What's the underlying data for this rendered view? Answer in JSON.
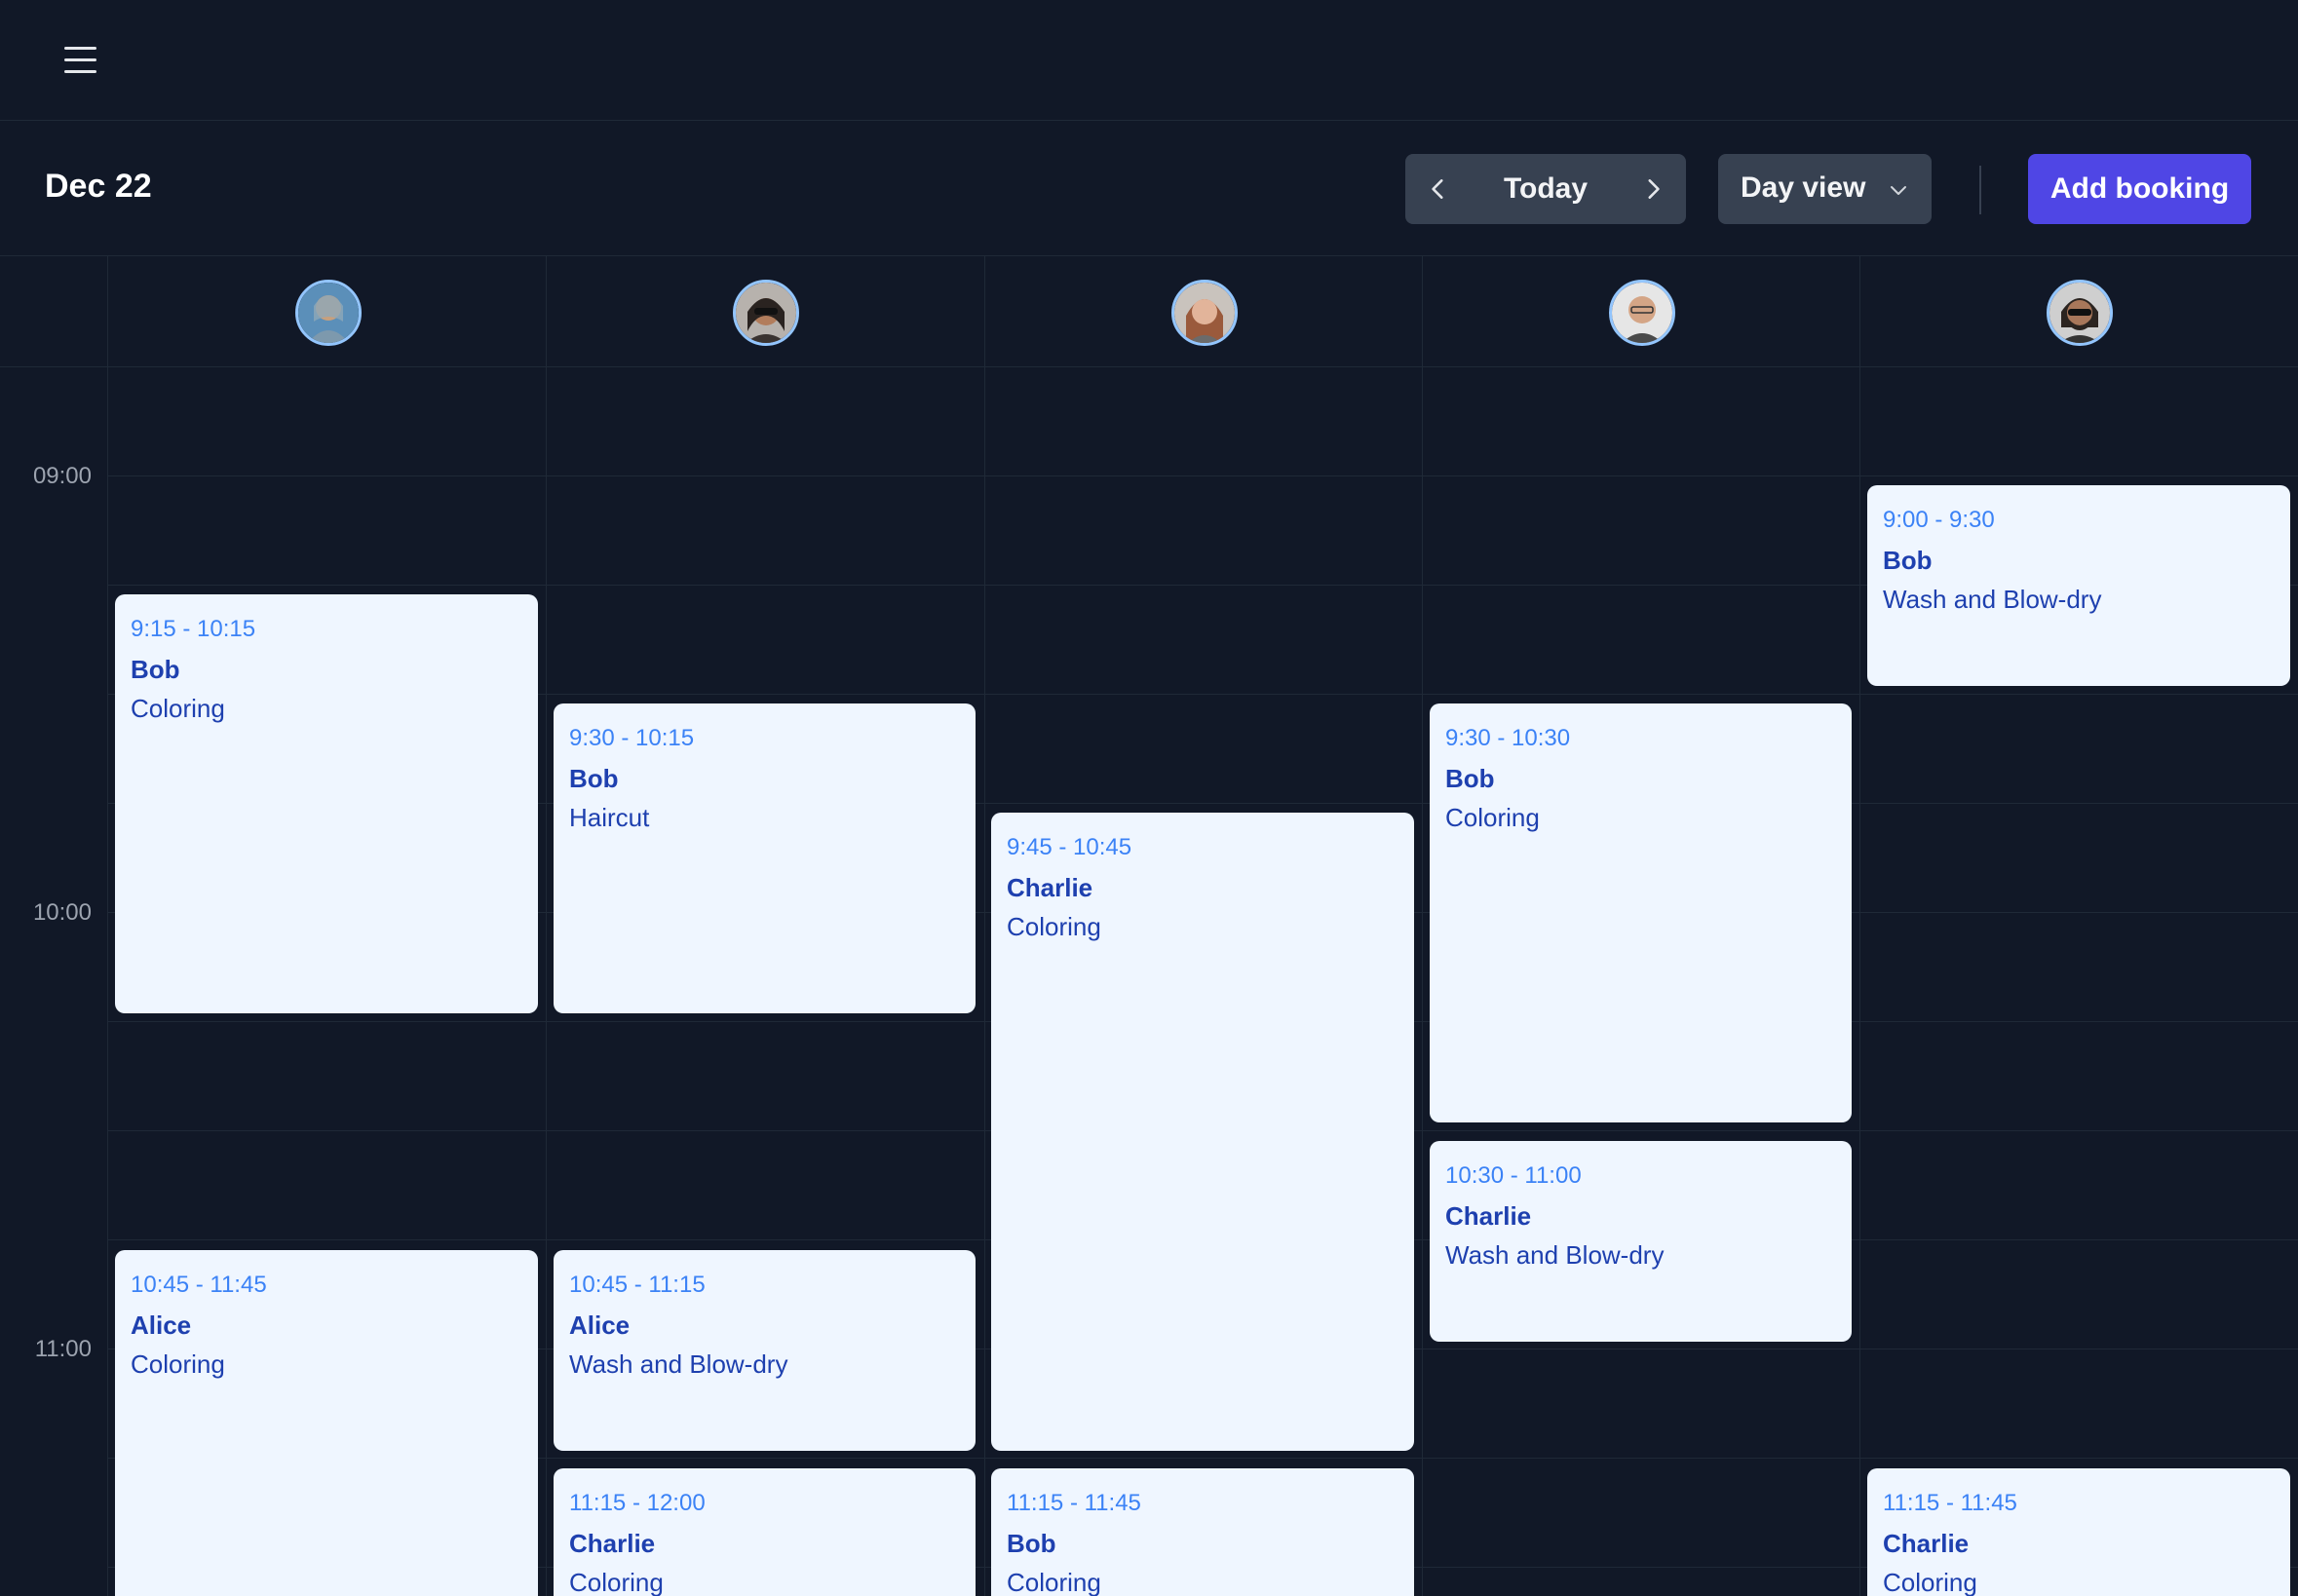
{
  "topbar": {
    "menu_icon": "hamburger-menu-icon"
  },
  "toolbar": {
    "date": "Dec 22",
    "prev_icon": "chevron-left-icon",
    "today_label": "Today",
    "next_icon": "chevron-right-icon",
    "view_label": "Day view",
    "view_icon": "chevron-down-icon",
    "add_booking_label": "Add booking"
  },
  "colors": {
    "background": "#111827",
    "control_bg": "#374151",
    "accent": "#4f46e5",
    "booking_bg": "#eff6ff",
    "booking_time": "#3b82f6",
    "booking_text": "#1e40af"
  },
  "time_labels": [
    "09:00",
    "10:00",
    "11:00"
  ],
  "staff": [
    {
      "avatar_icon": "staff-avatar-icon"
    },
    {
      "avatar_icon": "staff-avatar-icon"
    },
    {
      "avatar_icon": "staff-avatar-icon"
    },
    {
      "avatar_icon": "staff-avatar-icon"
    },
    {
      "avatar_icon": "staff-avatar-icon"
    }
  ],
  "bookings": [
    {
      "time": "9:15 - 10:15",
      "client": "Bob",
      "service": "Coloring"
    },
    {
      "time": "10:45 - 11:45",
      "client": "Alice",
      "service": "Coloring"
    },
    {
      "time": "9:30 - 10:15",
      "client": "Bob",
      "service": "Haircut"
    },
    {
      "time": "10:45 - 11:15",
      "client": "Alice",
      "service": "Wash and Blow-dry"
    },
    {
      "time": "11:15 - 12:00",
      "client": "Charlie",
      "service": "Coloring"
    },
    {
      "time": "9:45 - 10:45",
      "client": "Charlie",
      "service": "Coloring"
    },
    {
      "time": "11:15 - 11:45",
      "client": "Bob",
      "service": "Coloring"
    },
    {
      "time": "9:30 - 10:30",
      "client": "Bob",
      "service": "Coloring"
    },
    {
      "time": "10:30 - 11:00",
      "client": "Charlie",
      "service": "Wash and Blow-dry"
    },
    {
      "time": "9:00 - 9:30",
      "client": "Bob",
      "service": "Wash and Blow-dry"
    },
    {
      "time": "11:15 - 11:45",
      "client": "Charlie",
      "service": "Coloring"
    }
  ]
}
